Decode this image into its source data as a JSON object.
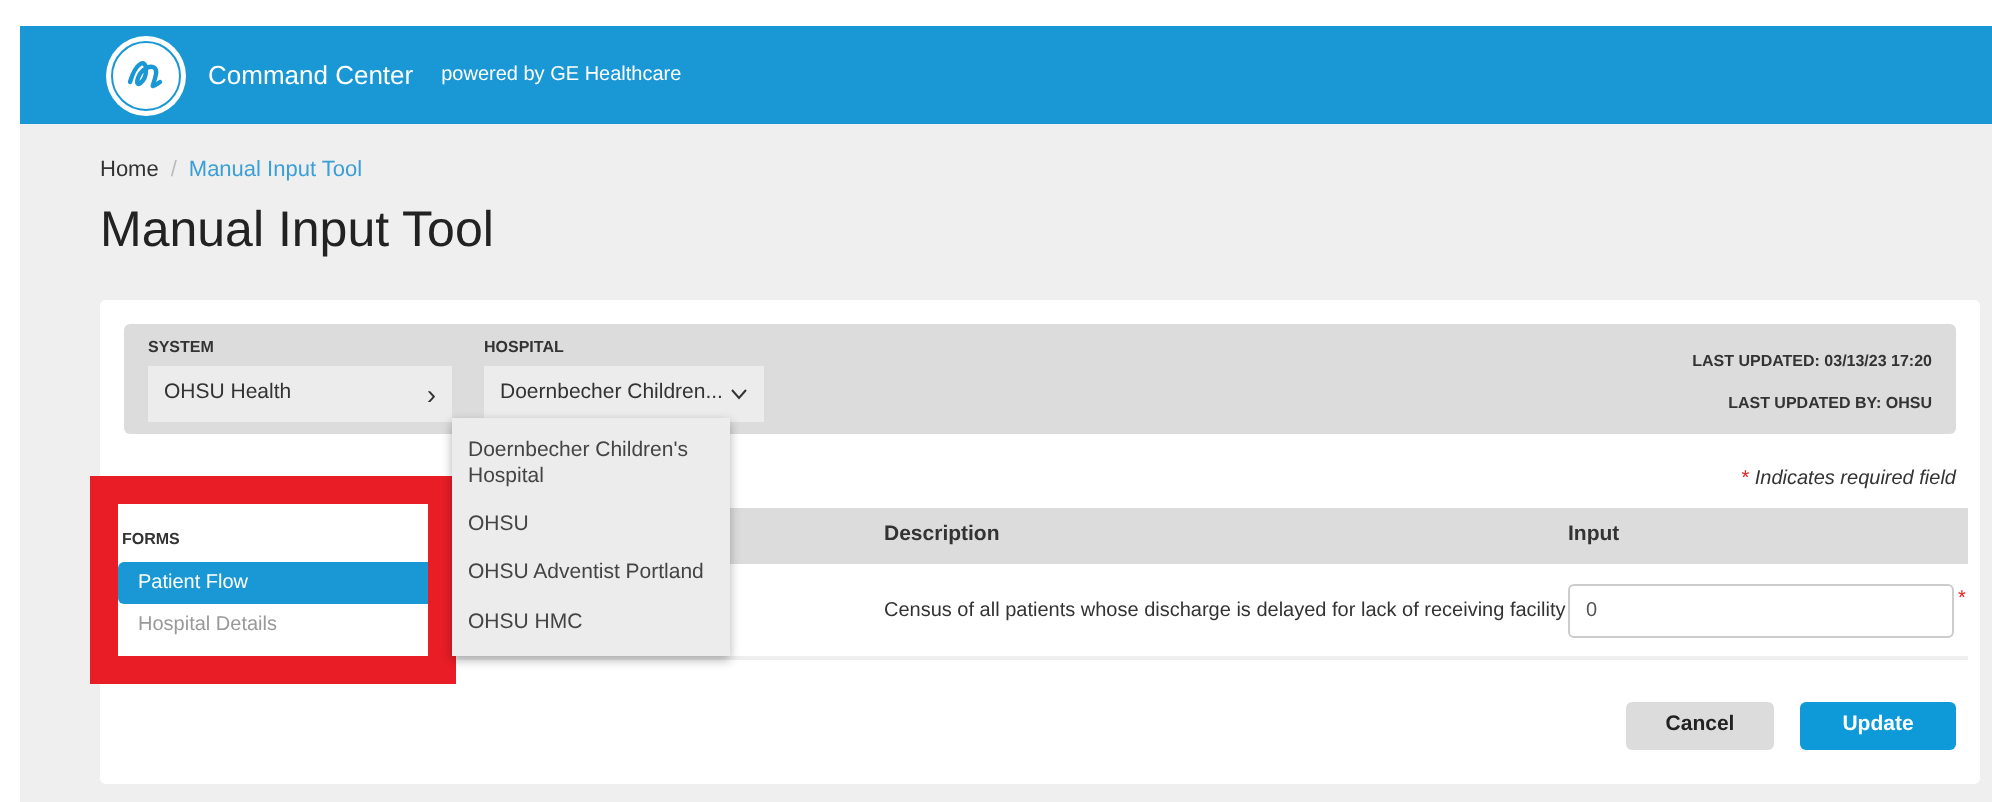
{
  "header": {
    "title": "Command Center",
    "subtitle": "powered by GE Healthcare"
  },
  "breadcrumb_separator": "/",
  "breadcrumb": [
    {
      "label": "Home",
      "selected": false
    },
    {
      "label": "Manual Input Tool",
      "selected": true
    }
  ],
  "page_title": "Manual Input Tool",
  "filters": {
    "system": {
      "label": "SYSTEM",
      "value": "OHSU Health",
      "chevron": "›"
    },
    "hospital": {
      "label": "HOSPITAL",
      "value": "Doernbecher Children...",
      "expanded": true,
      "options": [
        "Doernbecher Children's Hospital",
        "OHSU",
        "OHSU Adventist Portland",
        "OHSU HMC"
      ]
    },
    "last_updated": "LAST UPDATED: 03/13/23 17:20",
    "last_updated_by": "LAST UPDATED BY: OHSU"
  },
  "required_note": {
    "mark": "*",
    "text": "Indicates required field"
  },
  "forms": {
    "title": "FORMS",
    "items": [
      {
        "label": "Patient Flow",
        "selected": true
      },
      {
        "label": "Hospital Details",
        "selected": false
      }
    ]
  },
  "table": {
    "columns": [
      "Description",
      "Input"
    ],
    "rows": [
      {
        "description": "Census of all patients whose discharge is delayed for lack of receiving facility",
        "input": "0",
        "required_mark": "*"
      }
    ]
  },
  "buttons": [
    {
      "label": "Cancel",
      "kind": "secondary"
    },
    {
      "label": "Update",
      "kind": "primary"
    }
  ]
}
